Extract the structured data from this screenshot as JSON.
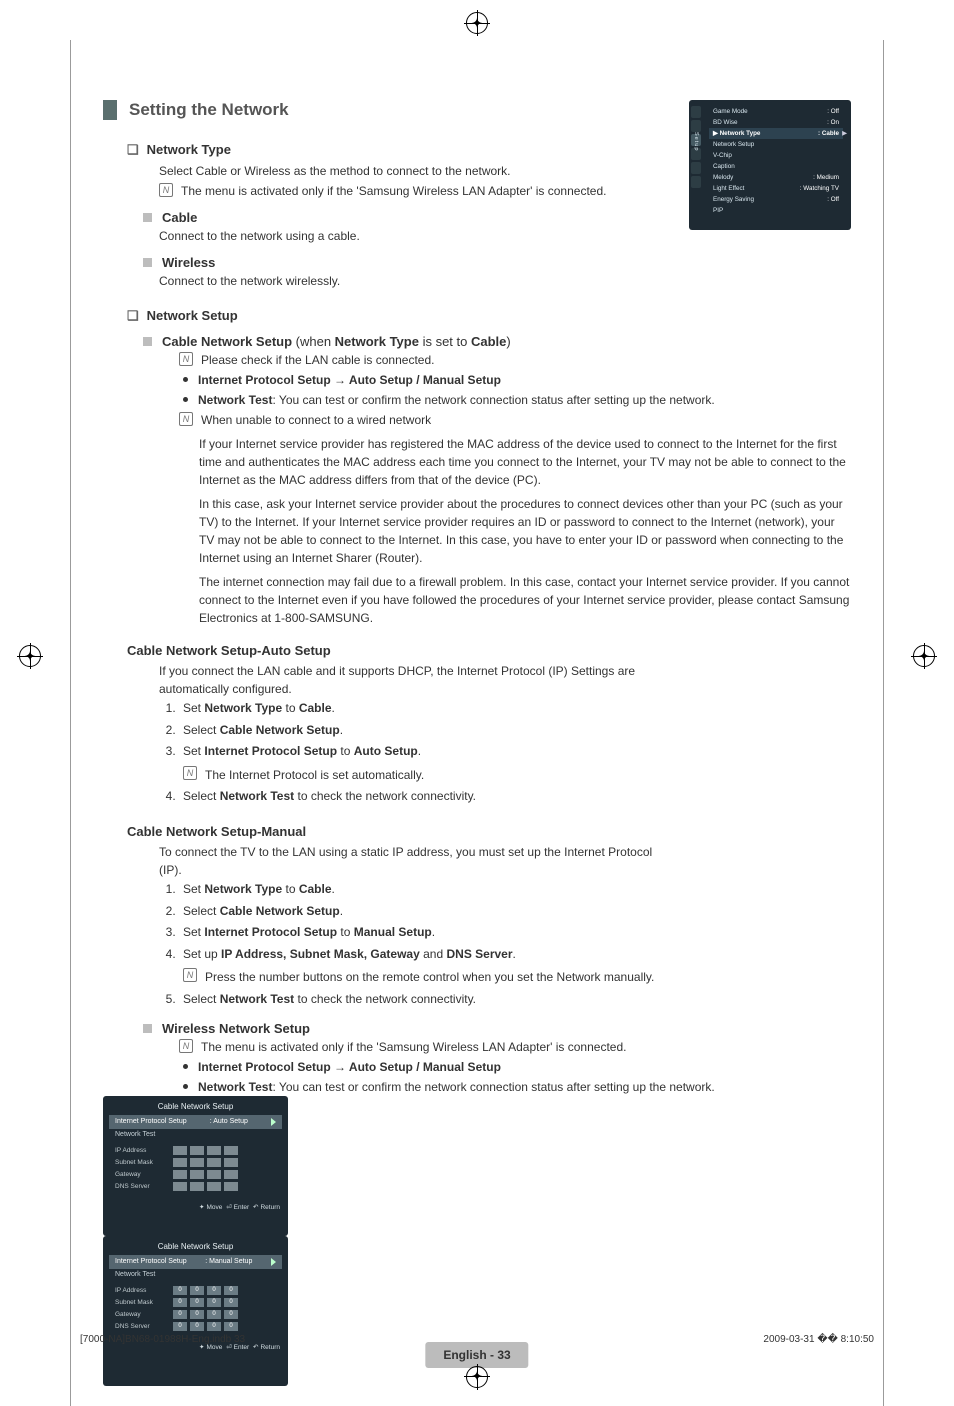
{
  "header": {
    "title": "Setting the Network"
  },
  "section_nt": {
    "title": "Network Type",
    "desc": "Select Cable or Wireless as the method to connect to the network.",
    "note": "The menu is activated only if the 'Samsung Wireless LAN Adapter' is connected.",
    "cable_title": "Cable",
    "cable_desc": "Connect to the network using a cable.",
    "wireless_title": "Wireless",
    "wireless_desc": "Connect to the network wirelessly."
  },
  "section_ns": {
    "title": "Network Setup",
    "cns_prefix": "Cable Network Setup",
    "cns_when": " (when ",
    "cns_nt": "Network Type",
    "cns_set": " is set to ",
    "cns_cable": "Cable",
    "cns_close": ")",
    "note1": "Please check if the LAN cable is connected.",
    "b1a": "Internet Protocol Setup → Auto Setup / Manual Setup",
    "b2a": "Network Test",
    "b2b": ": You can test or confirm the network connection status after setting up the network.",
    "note2": "When unable to connect to a wired network",
    "p1": "If your Internet service provider has registered the MAC address of the device used to connect to the Internet for the first time and authenticates the MAC address each time you connect to the Internet, your TV may not be able to connect to the Internet as the MAC address differs from that of the device (PC).",
    "p2": "In this case, ask your Internet service provider about the procedures to connect devices other than your PC (such as your TV) to the Internet. If your Internet service provider requires an ID or password to connect to the Internet (network), your TV may not be able to connect to the Internet. In this case, you have to enter your ID or password when connecting to the Internet using an Internet Sharer (Router).",
    "p3": "The internet connection may fail due to a firewall problem. In this case, contact your Internet service provider. If you cannot connect to the Internet even if you have followed the procedures of your Internet service provider, please contact Samsung Electronics at 1-800-SAMSUNG."
  },
  "auto": {
    "title": "Cable Network Setup-Auto Setup",
    "intro": "If you connect the LAN cable and it supports DHCP, the Internet Protocol (IP) Settings are automatically configured.",
    "s1a": "Set ",
    "s1b": "Network Type",
    "s1c": " to ",
    "s1d": "Cable",
    "s1e": ".",
    "s2a": "Select ",
    "s2b": "Cable Network Setup",
    "s2c": ".",
    "s3a": "Set ",
    "s3b": "Internet Protocol Setup",
    "s3c": " to ",
    "s3d": "Auto Setup",
    "s3e": ".",
    "s3note": "The Internet Protocol is set automatically.",
    "s4a": "Select ",
    "s4b": "Network Test",
    "s4c": " to check the network connectivity."
  },
  "manual": {
    "title": "Cable Network Setup-Manual",
    "intro": "To connect the TV to the LAN using a static IP address, you must set up the Internet Protocol (IP).",
    "s1a": "Set ",
    "s1b": "Network Type",
    "s1c": " to ",
    "s1d": "Cable",
    "s1e": ".",
    "s2a": "Select ",
    "s2b": "Cable Network Setup",
    "s2c": ".",
    "s3a": "Set ",
    "s3b": "Internet Protocol Setup",
    "s3c": " to ",
    "s3d": "Manual Setup",
    "s3e": ".",
    "s4a": "Set up ",
    "s4b": "IP Address, Subnet Mask, Gateway",
    "s4c": " and ",
    "s4d": "DNS Server",
    "s4e": ".",
    "s4note": "Press the number buttons on the remote control when you set the Network manually.",
    "s5a": "Select ",
    "s5b": "Network Test",
    "s5c": " to check the network connectivity."
  },
  "wns": {
    "title": "Wireless Network Setup",
    "note": "The menu is activated only if the 'Samsung Wireless LAN Adapter' is connected.",
    "b1": "Internet Protocol Setup → Auto Setup / Manual Setup",
    "b2a": "Network Test",
    "b2b": ": You can test or confirm the network connection status after setting up the network."
  },
  "shot1": {
    "side_label": "Setup",
    "rows": [
      {
        "l": "Game Mode",
        "r": ": Off"
      },
      {
        "l": "BD Wise",
        "r": ": On"
      }
    ],
    "sel": {
      "l": "▶ Network Type",
      "r": ": Cable"
    },
    "rows2": [
      {
        "l": "Network Setup",
        "r": ""
      },
      {
        "l": "V-Chip",
        "r": ""
      },
      {
        "l": "Caption",
        "r": ""
      },
      {
        "l": "Melody",
        "r": ": Medium"
      },
      {
        "l": "Light Effect",
        "r": ": Watching TV"
      },
      {
        "l": "Energy Saving",
        "r": ": Off"
      },
      {
        "l": "PIP",
        "r": ""
      }
    ]
  },
  "shot2": {
    "title": "Cable Network Setup",
    "row1": "Internet Protocol Setup",
    "row1v": ": Auto Setup",
    "row2": "Network Test",
    "labels": [
      "IP Address",
      "Subnet Mask",
      "Gateway",
      "DNS Server"
    ],
    "foot_move": "Move",
    "foot_enter": "Enter",
    "foot_return": "Return"
  },
  "shot3": {
    "title": "Cable Network Setup",
    "row1": "Internet Protocol Setup",
    "row1v": ": Manual Setup",
    "row2": "Network Test",
    "labels": [
      "IP Address",
      "Subnet Mask",
      "Gateway",
      "DNS Server"
    ],
    "vals": [
      [
        "0",
        "0",
        "0",
        "0"
      ],
      [
        "0",
        "0",
        "0",
        "0"
      ],
      [
        "0",
        "0",
        "0",
        "0"
      ],
      [
        "0",
        "0",
        "0",
        "0"
      ]
    ],
    "foot_move": "Move",
    "foot_enter": "Enter",
    "foot_return": "Return"
  },
  "footer": {
    "text": "English - 33"
  },
  "meta": {
    "file": "[7000-NA]BN68-01988H-Eng.indb   33",
    "date": "2009-03-31   �� 8:10:50"
  }
}
